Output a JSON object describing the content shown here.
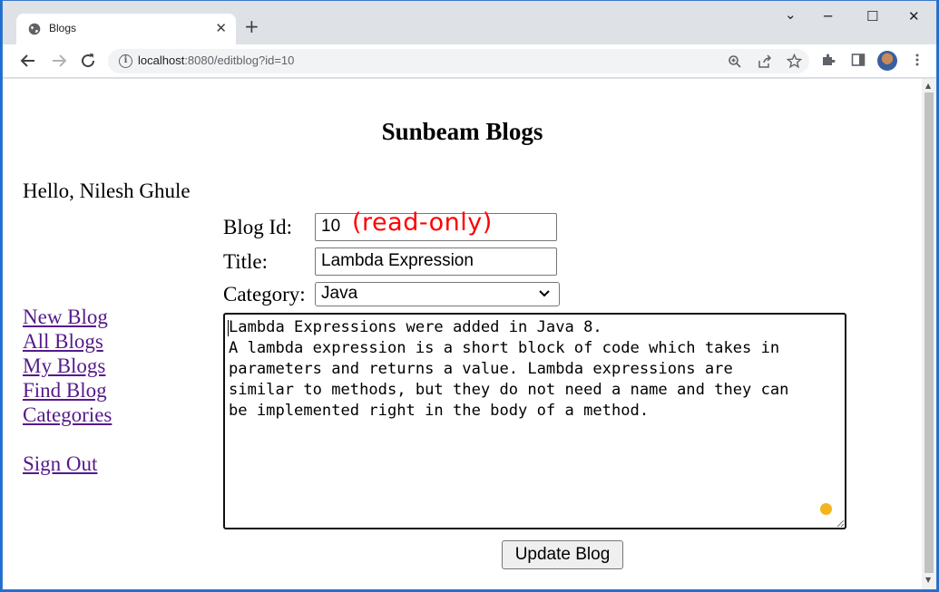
{
  "browser": {
    "tab_title": "Blogs",
    "tab_close": "✕",
    "new_tab": "+",
    "minimize": "─",
    "maximize": "☐",
    "close": "✕",
    "chevron": "⌄",
    "url_host": "localhost",
    "url_path": ":8080/editblog?id=10",
    "icons": [
      "back-icon",
      "forward-icon",
      "reload-icon",
      "info-icon",
      "zoom-icon",
      "share-icon",
      "star-icon",
      "extensions-icon",
      "sidepanel-icon",
      "menu-icon"
    ]
  },
  "page": {
    "title": "Sunbeam Blogs",
    "greeting": "Hello, Nilesh Ghule",
    "nav": [
      "New Blog",
      "All Blogs",
      "My Blogs",
      "Find Blog",
      "Categories",
      "Sign Out"
    ]
  },
  "form": {
    "id_label": "Blog Id:",
    "id_value": "10",
    "readonly_note": "(read-only)",
    "title_label": "Title:",
    "title_value": "Lambda Expression",
    "category_label": "Category:",
    "category_value": "Java",
    "contents": "Lambda Expressions were added in Java 8.\nA lambda expression is a short block of code which takes in\nparameters and returns a value. Lambda expressions are\nsimilar to methods, but they do not need a name and they can\nbe implemented right in the body of a method.",
    "submit_label": "Update Blog"
  },
  "colors": {
    "link": "#551a8b",
    "annotation": "#ff0000",
    "indicator_dot": "#f5b41c"
  }
}
